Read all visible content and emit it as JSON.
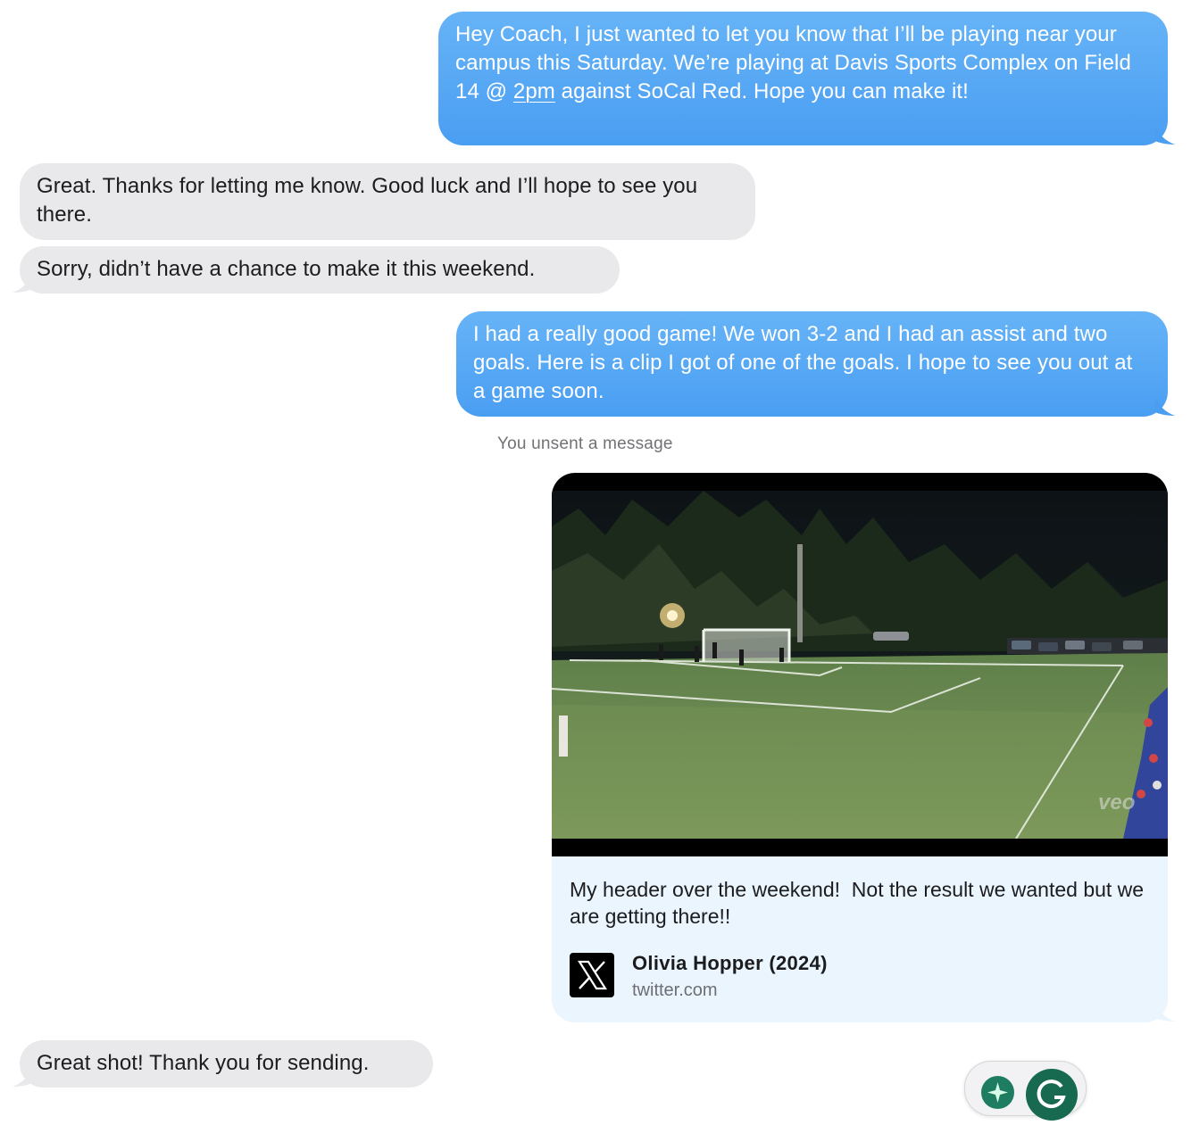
{
  "messages": {
    "m1": {
      "direction": "outgoing",
      "pre": "Hey Coach, I just wanted to let you know that I’ll be playing near your campus this Saturday. We’re playing at Davis Sports Complex on Field 14 @ ",
      "link": "2pm",
      "post": " against SoCal Red. Hope you can make it!"
    },
    "m2": {
      "direction": "incoming",
      "text": "Great. Thanks for letting me know. Good luck and I’ll hope to see you there."
    },
    "m3": {
      "direction": "incoming",
      "text": "Sorry, didn’t have a chance to make it this weekend."
    },
    "m4": {
      "direction": "outgoing",
      "text": "I had a really good game! We won 3-2 and I had an assist and two goals. Here is a clip I got of one of the goals. I hope to see you out at a game soon."
    },
    "unsent_notice": "You unsent a message",
    "m5": {
      "direction": "outgoing",
      "type": "link-preview",
      "description": "My header over the weekend!  Not the result we wanted but we are getting there!!",
      "source_title": "Olivia Hopper (2024)",
      "source_domain": "twitter.com",
      "watermark": "veo",
      "icon": "x-logo-icon"
    },
    "m6": {
      "direction": "incoming",
      "text": "Great shot! Thank you for sending."
    }
  },
  "colors": {
    "outgoing_bubble": "#4a9ef2",
    "incoming_bubble": "#e9e9eb",
    "card_background": "#eaf5fe",
    "widget_accent": "#17694f"
  },
  "widget": {
    "icons": [
      "sparkle-icon",
      "grammarly-g-icon"
    ]
  }
}
